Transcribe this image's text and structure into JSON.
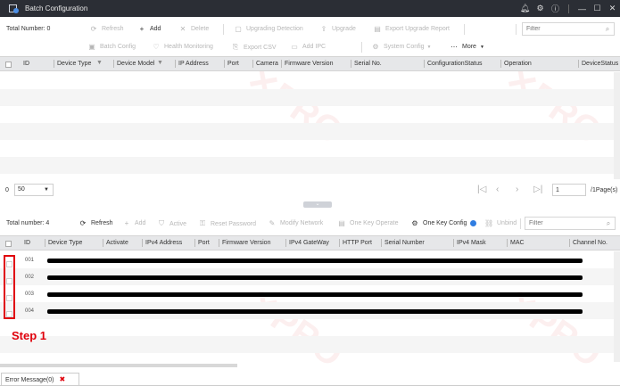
{
  "window": {
    "title": "Batch Configuration"
  },
  "toolbar_top": {
    "total_label": "Total Number: 0",
    "items": [
      {
        "label": "Refresh",
        "icon": "refresh-icon",
        "enabled": false
      },
      {
        "label": "Add",
        "icon": "plus-icon",
        "enabled": true
      },
      {
        "label": "Delete",
        "icon": "x-icon",
        "enabled": false
      },
      {
        "label": "Upgrading Detection",
        "icon": "detect-icon",
        "enabled": false
      },
      {
        "label": "Upgrade",
        "icon": "upgrade-icon",
        "enabled": false
      },
      {
        "label": "Export Upgrade Report",
        "icon": "report-icon",
        "enabled": false
      },
      {
        "label": "Batch Config",
        "icon": "config-icon",
        "enabled": false
      },
      {
        "label": "Health Monitoring",
        "icon": "health-icon",
        "enabled": false
      },
      {
        "label": "Export CSV",
        "icon": "export-icon",
        "enabled": false
      },
      {
        "label": "Add IPC",
        "icon": "camera-icon",
        "enabled": false
      },
      {
        "label": "System Config",
        "icon": "gear-icon",
        "enabled": false
      },
      {
        "label": "More",
        "icon": "more-icon",
        "enabled": true
      }
    ],
    "filter_placeholder": "Filter"
  },
  "table_top": {
    "columns": [
      "ID",
      "Device Type",
      "Device Model",
      "IP Address",
      "Port",
      "Camera",
      "Firmware Version",
      "Serial No.",
      "ConfigurationStatus",
      "Operation",
      "DeviceStatus"
    ]
  },
  "pager": {
    "page_size": "50",
    "page_value": "1",
    "page_total": "/1Page(s)"
  },
  "toolbar_bottom": {
    "total_label": "Total number: 4",
    "items": [
      {
        "label": "Refresh",
        "icon": "refresh-icon",
        "enabled": true
      },
      {
        "label": "Add",
        "icon": "plus-icon",
        "enabled": false
      },
      {
        "label": "Active",
        "icon": "shield-icon",
        "enabled": false
      },
      {
        "label": "Reset Password",
        "icon": "key-icon",
        "enabled": false
      },
      {
        "label": "Modify Network",
        "icon": "edit-icon",
        "enabled": false
      },
      {
        "label": "One Key Operate",
        "icon": "operate-icon",
        "enabled": false
      },
      {
        "label": "One Key Config",
        "icon": "gear-icon",
        "enabled": true
      },
      {
        "label": "Unbind",
        "icon": "unlink-icon",
        "enabled": false
      }
    ],
    "filter_placeholder": "Filter"
  },
  "table_bottom": {
    "columns": [
      "ID",
      "Device Type",
      "Activate",
      "IPv4 Address",
      "Port",
      "Firmware Version",
      "IPv4 GateWay",
      "HTTP Port",
      "Serial Number",
      "IPv4 Mask",
      "MAC",
      "Channel No."
    ],
    "rows": [
      {
        "id": "001"
      },
      {
        "id": "002"
      },
      {
        "id": "003"
      },
      {
        "id": "004"
      }
    ]
  },
  "annotation": {
    "step_label": "Step 1"
  },
  "status": {
    "error_tab": "Error Message(0)"
  },
  "colors": {
    "titlebar": "#2b2e35",
    "annotation_red": "#e0000c",
    "header_bg": "#e6e7e9",
    "info_blue": "#2f7de1"
  }
}
